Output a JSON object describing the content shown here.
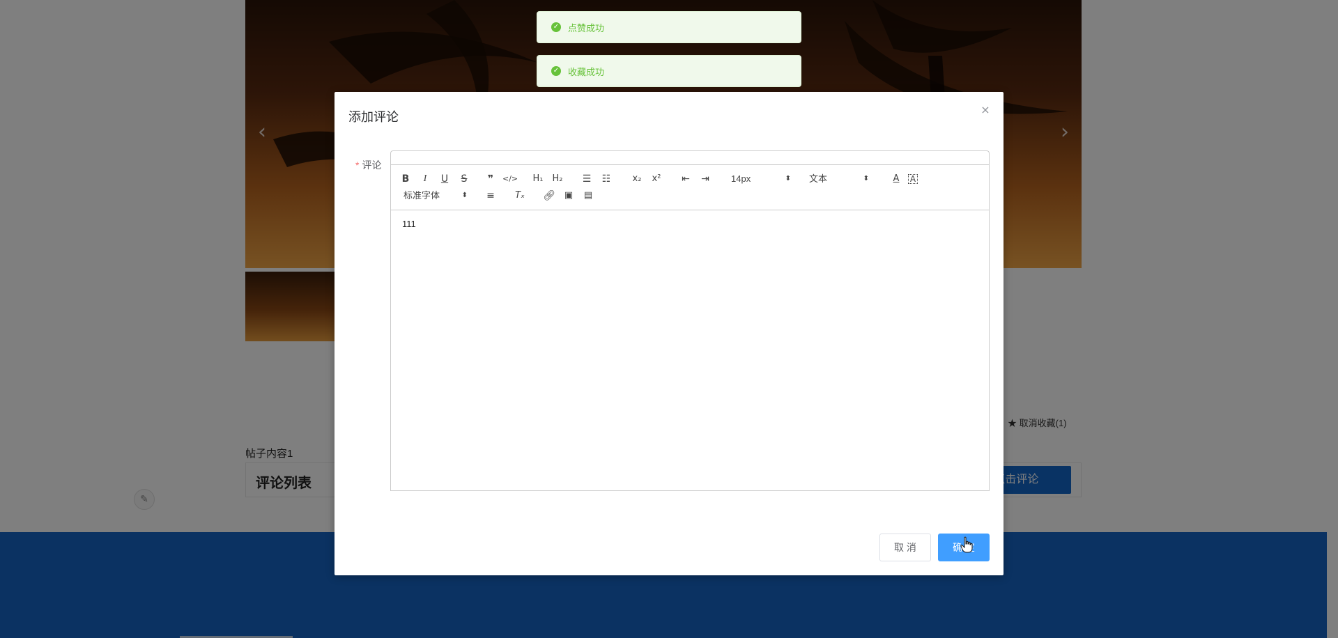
{
  "background": {
    "carousel_prev": "‹",
    "carousel_next": "›",
    "favorite_label": "取消收藏(1)",
    "post_content": "帖子内容1",
    "comment_list_title": "评论列表",
    "click_comment_label": "点击评论"
  },
  "toasts": [
    {
      "message": "点赞成功"
    },
    {
      "message": "收藏成功"
    }
  ],
  "dialog": {
    "title": "添加评论",
    "close_icon": "×",
    "field_label": "评论",
    "required_mark": "*",
    "editor": {
      "font_size_value": "14px",
      "header_value": "文本",
      "font_family_value": "标准字体",
      "content": "111"
    },
    "cancel_label": "取 消",
    "ok_label": "确 定"
  },
  "colors": {
    "primary": "#409eff",
    "success": "#67c23a",
    "footer": "#1665c5",
    "comment_button": "#1266c9"
  }
}
